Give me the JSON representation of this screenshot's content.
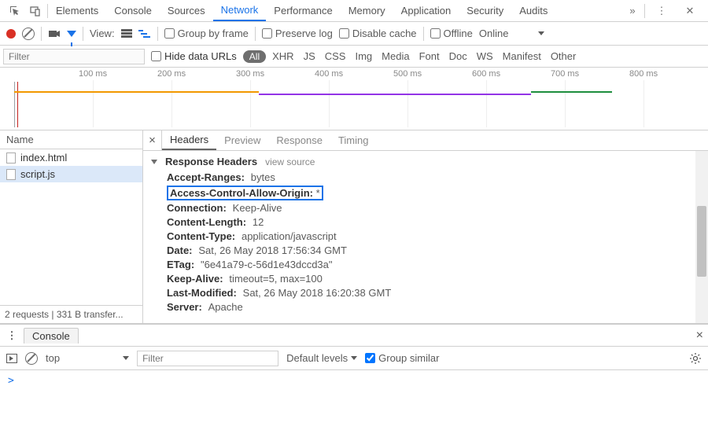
{
  "topTabs": [
    "Elements",
    "Console",
    "Sources",
    "Network",
    "Performance",
    "Memory",
    "Application",
    "Security",
    "Audits"
  ],
  "topActive": "Network",
  "toolbar": {
    "viewLabel": "View:",
    "groupByFrame": "Group by frame",
    "preserveLog": "Preserve log",
    "disableCache": "Disable cache",
    "offline": "Offline",
    "online": "Online"
  },
  "filterbar": {
    "placeholder": "Filter",
    "hideData": "Hide data URLs",
    "all": "All",
    "types": [
      "XHR",
      "JS",
      "CSS",
      "Img",
      "Media",
      "Font",
      "Doc",
      "WS",
      "Manifest",
      "Other"
    ]
  },
  "timeline": {
    "ticks": [
      "100 ms",
      "200 ms",
      "300 ms",
      "400 ms",
      "500 ms",
      "600 ms",
      "700 ms",
      "800 ms"
    ]
  },
  "sidebar": {
    "head": "Name",
    "files": [
      "index.html",
      "script.js"
    ],
    "selectedIndex": 1,
    "footer": "2 requests | 331 B transfer..."
  },
  "details": {
    "tabs": [
      "Headers",
      "Preview",
      "Response",
      "Timing"
    ],
    "activeTab": "Headers",
    "sectionTitle": "Response Headers",
    "viewSource": "view source",
    "headers": [
      {
        "k": "Accept-Ranges:",
        "v": "bytes",
        "hl": false
      },
      {
        "k": "Access-Control-Allow-Origin:",
        "v": "*",
        "hl": true
      },
      {
        "k": "Connection:",
        "v": "Keep-Alive",
        "hl": false
      },
      {
        "k": "Content-Length:",
        "v": "12",
        "hl": false
      },
      {
        "k": "Content-Type:",
        "v": "application/javascript",
        "hl": false
      },
      {
        "k": "Date:",
        "v": "Sat, 26 May 2018 17:56:34 GMT",
        "hl": false
      },
      {
        "k": "ETag:",
        "v": "\"6e41a79-c-56d1e43dccd3a\"",
        "hl": false
      },
      {
        "k": "Keep-Alive:",
        "v": "timeout=5, max=100",
        "hl": false
      },
      {
        "k": "Last-Modified:",
        "v": "Sat, 26 May 2018 16:20:38 GMT",
        "hl": false
      },
      {
        "k": "Server:",
        "v": "Apache",
        "hl": false
      }
    ]
  },
  "drawer": {
    "tab": "Console",
    "context": "top",
    "filterPlaceholder": "Filter",
    "levels": "Default levels",
    "groupSimilar": "Group similar",
    "prompt": ">"
  }
}
